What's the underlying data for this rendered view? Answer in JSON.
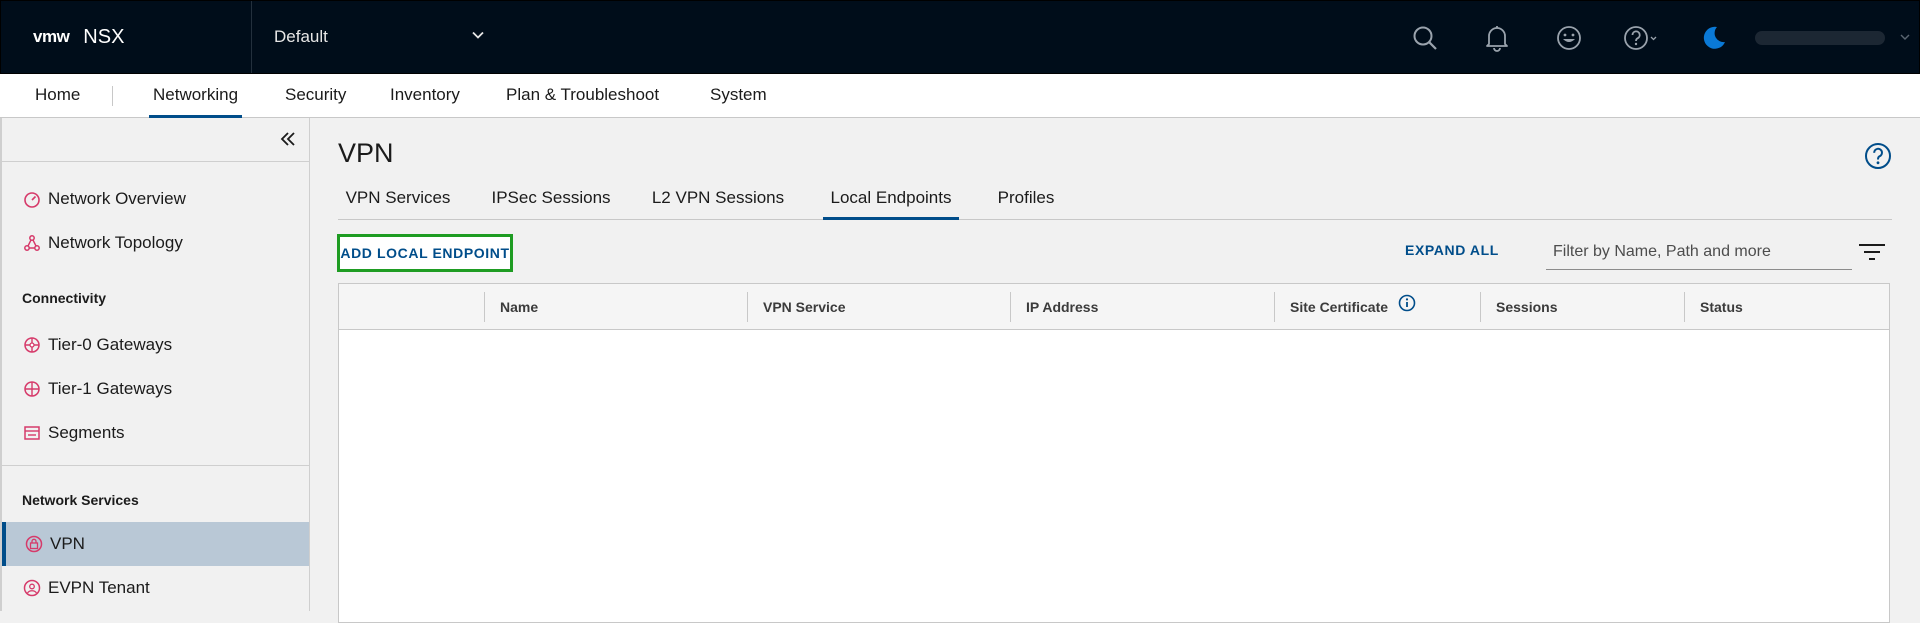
{
  "header": {
    "logo": "vmw",
    "product": "NSX",
    "project": "Default",
    "icons": [
      "search-icon",
      "bell-icon",
      "smiley-icon",
      "help-icon",
      "moon-icon"
    ]
  },
  "nav": {
    "items": [
      {
        "label": "Home"
      },
      {
        "label": "Networking"
      },
      {
        "label": "Security"
      },
      {
        "label": "Inventory"
      },
      {
        "label": "Plan & Troubleshoot"
      },
      {
        "label": "System"
      }
    ],
    "active": "Networking"
  },
  "sidebar": {
    "items": [
      {
        "label": "Network Overview",
        "icon": "gauge-icon"
      },
      {
        "label": "Network Topology",
        "icon": "topology-icon"
      }
    ],
    "connectivity_heading": "Connectivity",
    "connectivity": [
      {
        "label": "Tier-0 Gateways",
        "icon": "gateway-icon"
      },
      {
        "label": "Tier-1 Gateways",
        "icon": "gateway-icon"
      },
      {
        "label": "Segments",
        "icon": "segments-icon"
      }
    ],
    "services_heading": "Network Services",
    "services": [
      {
        "label": "VPN",
        "icon": "vpn-icon"
      },
      {
        "label": "EVPN Tenant",
        "icon": "evpn-icon"
      }
    ],
    "active": "VPN"
  },
  "main": {
    "title": "VPN",
    "tabs": [
      {
        "label": "VPN Services"
      },
      {
        "label": "IPSec Sessions"
      },
      {
        "label": "L2 VPN Sessions"
      },
      {
        "label": "Local Endpoints"
      },
      {
        "label": "Profiles"
      }
    ],
    "active_tab": "Local Endpoints",
    "add_button": "ADD LOCAL ENDPOINT",
    "expand_all": "EXPAND ALL",
    "filter_placeholder": "Filter by Name, Path and more",
    "columns": [
      "Name",
      "VPN Service",
      "IP Address",
      "Site Certificate",
      "Sessions",
      "Status"
    ]
  },
  "colors": {
    "header_bg": "#000d1a",
    "accent": "#004d8a",
    "icon_pink": "#d63a6a",
    "highlight_green": "#1e9c22"
  }
}
